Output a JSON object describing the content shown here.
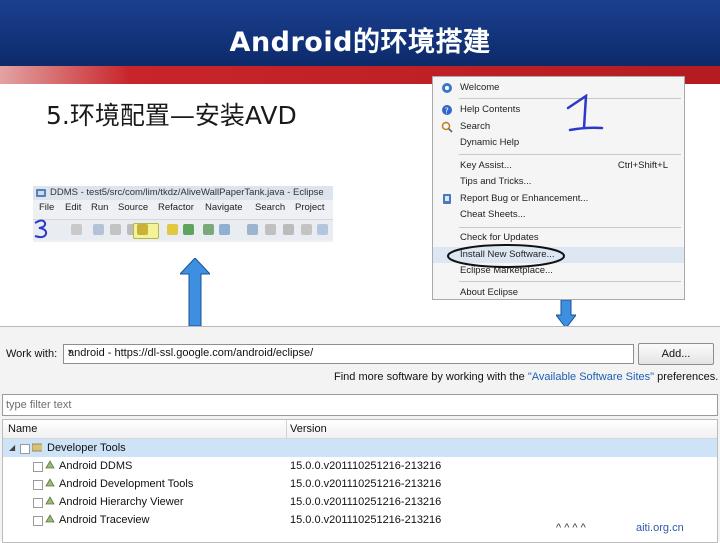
{
  "slide": {
    "title": "Android的环境搭建",
    "subtitle": "5.环境配置—安装AVD",
    "annotations": {
      "step1": "1",
      "step3": "3"
    },
    "footer": {
      "logo_text": "^ ^ ^ ^",
      "url": "aiti.org.cn"
    }
  },
  "help_menu": {
    "items": [
      {
        "label": "Welcome",
        "icon": "welcome-icon"
      },
      {
        "label": "Help Contents",
        "icon": "help-icon"
      },
      {
        "label": "Search",
        "icon": "search-icon"
      },
      {
        "label": "Dynamic Help",
        "icon": ""
      },
      {
        "label": "Key Assist...",
        "shortcut": "Ctrl+Shift+L",
        "icon": ""
      },
      {
        "label": "Tips and Tricks...",
        "icon": ""
      },
      {
        "label": "Report Bug or Enhancement...",
        "icon": "bug-report-icon"
      },
      {
        "label": "Cheat Sheets...",
        "icon": ""
      },
      {
        "label": "Check for Updates",
        "icon": ""
      },
      {
        "label": "Install New Software...",
        "icon": ""
      },
      {
        "label": "Eclipse Marketplace...",
        "icon": ""
      },
      {
        "label": "About Eclipse",
        "icon": ""
      }
    ],
    "highlighted": "Install New Software..."
  },
  "eclipse_window": {
    "title": "DDMS - test5/src/com/lim/tkdz/AliveWallPaperTank.java - Eclipse",
    "menus": [
      "File",
      "Edit",
      "Run",
      "Source",
      "Refactor",
      "Navigate",
      "Search",
      "Project"
    ]
  },
  "install_dialog": {
    "work_with_label": "Work with:",
    "work_with_value": "android - https://dl-ssl.google.com/android/eclipse/",
    "add_button": "Add...",
    "find_more_prefix": "Find more software by working with the ",
    "find_more_link": "\"Available Software Sites\"",
    "find_more_suffix": " preferences.",
    "filter_placeholder": "type filter text",
    "columns": {
      "name": "Name",
      "version": "Version"
    },
    "group": {
      "name": "Developer Tools",
      "icon": "software-group-icon"
    },
    "rows": [
      {
        "name": "Android DDMS",
        "version": "15.0.0.v201110251216-213216"
      },
      {
        "name": "Android Development Tools",
        "version": "15.0.0.v201110251216-213216"
      },
      {
        "name": "Android Hierarchy Viewer",
        "version": "15.0.0.v201110251216-213216"
      },
      {
        "name": "Android Traceview",
        "version": "15.0.0.v201110251216-213216"
      }
    ]
  },
  "colors": {
    "banner": "#12337a",
    "red_band": "#b41c21",
    "link": "#1d5fb3",
    "arrow": "#3d8fe0"
  }
}
